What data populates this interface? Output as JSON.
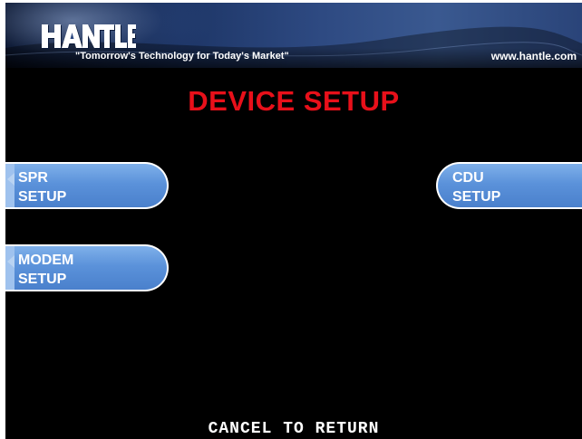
{
  "header": {
    "logo_text": "HANTLE",
    "tagline": "\"Tomorrow's Technology for Today's Market\"",
    "url": "www.hantle.com"
  },
  "screen": {
    "title": "DEVICE SETUP",
    "footer": "CANCEL TO RETURN"
  },
  "buttons": {
    "spr": {
      "line1": "SPR",
      "line2": "SETUP"
    },
    "modem": {
      "line1": "MODEM",
      "line2": "SETUP"
    },
    "cdu": {
      "line1": "CDU",
      "line2": "SETUP"
    }
  },
  "colors": {
    "background": "#000000",
    "title": "#e8101a",
    "button": "#5b92da",
    "banner": "#2e4a82"
  }
}
